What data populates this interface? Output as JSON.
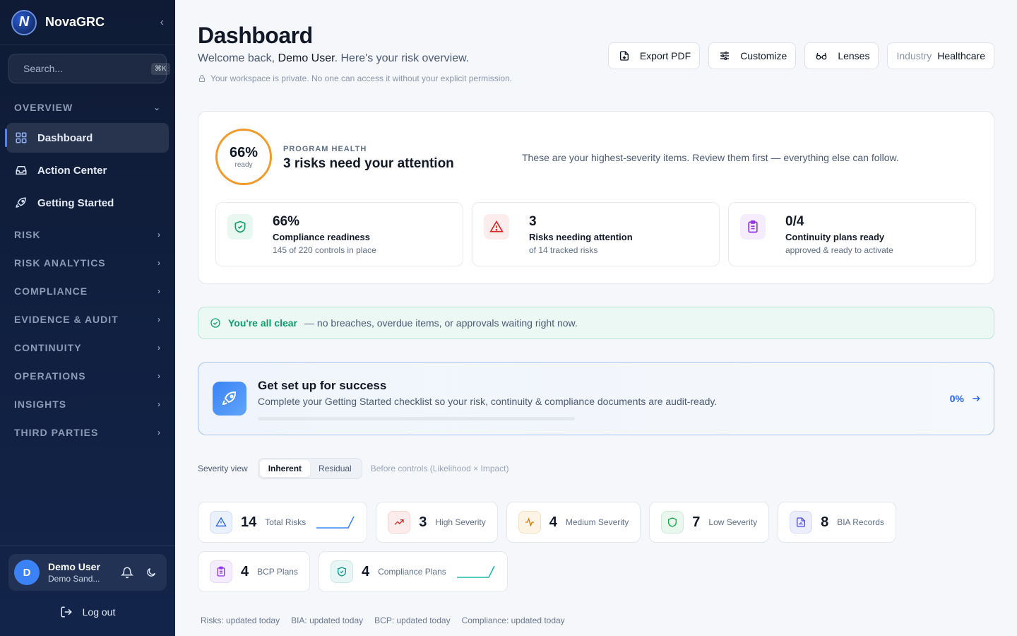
{
  "brand": {
    "name": "NovaGRC",
    "logo_letter": "N"
  },
  "search": {
    "placeholder": "Search...",
    "shortcut": "⌘K"
  },
  "sidebar": {
    "overview_label": "OVERVIEW",
    "items": [
      {
        "label": "Dashboard",
        "icon": "grid-icon",
        "active": true
      },
      {
        "label": "Action Center",
        "icon": "inbox-icon"
      },
      {
        "label": "Getting Started",
        "icon": "rocket-icon"
      }
    ],
    "sections": [
      "RISK",
      "RISK ANALYTICS",
      "COMPLIANCE",
      "EVIDENCE & AUDIT",
      "CONTINUITY",
      "OPERATIONS",
      "INSIGHTS",
      "THIRD PARTIES"
    ]
  },
  "user": {
    "initial": "D",
    "name": "Demo User",
    "org": "Demo Sand..."
  },
  "logout_label": "Log out",
  "header": {
    "title": "Dashboard",
    "welcome_prefix": "Welcome back, ",
    "welcome_name": "Demo User",
    "welcome_suffix": ". Here's your risk overview.",
    "privacy": "Your workspace is private. No one can access it without your explicit permission.",
    "export_label": "Export PDF",
    "customize_label": "Customize",
    "lenses_label": "Lenses",
    "industry_label": "Industry",
    "industry_value": "Healthcare"
  },
  "health": {
    "ring_value": "66%",
    "ring_sub": "ready",
    "ring_fraction": 0.66,
    "label": "PROGRAM HEALTH",
    "title": "3 risks need your attention",
    "description": "These are your highest-severity items. Review them first — everything else can follow.",
    "kpis": [
      {
        "value": "66%",
        "label": "Compliance readiness",
        "sub": "145 of 220 controls in place",
        "icon": "shield-check-icon",
        "color": "#0f9d6b"
      },
      {
        "value": "3",
        "label": "Risks needing attention",
        "sub": "of 14 tracked risks",
        "icon": "alert-triangle-icon",
        "color": "#dc2626"
      },
      {
        "value": "0/4",
        "label": "Continuity plans ready",
        "sub": "approved & ready to activate",
        "icon": "clipboard-icon",
        "color": "#9333ea"
      }
    ]
  },
  "clear_banner": {
    "strong": "You're all clear",
    "text": "— no breaches, overdue items, or approvals waiting right now."
  },
  "setup": {
    "title": "Get set up for success",
    "description": "Complete your Getting Started checklist so your risk, continuity & compliance documents are audit-ready.",
    "progress": 0,
    "progress_label": "0%"
  },
  "severity": {
    "label": "Severity view",
    "options": [
      "Inherent",
      "Residual"
    ],
    "selected": "Inherent",
    "hint": "Before controls (Likelihood × Impact)"
  },
  "stats": [
    {
      "value": "14",
      "label": "Total Risks",
      "icon": "alert-triangle-icon",
      "color": "#2563eb",
      "spark": true
    },
    {
      "value": "3",
      "label": "High Severity",
      "icon": "trending-up-icon",
      "color": "#dc2626"
    },
    {
      "value": "4",
      "label": "Medium Severity",
      "icon": "activity-icon",
      "color": "#d97706"
    },
    {
      "value": "7",
      "label": "Low Severity",
      "icon": "shield-icon",
      "color": "#16a34a"
    },
    {
      "value": "8",
      "label": "BIA Records",
      "icon": "file-chart-icon",
      "color": "#4f46e5"
    },
    {
      "value": "4",
      "label": "BCP Plans",
      "icon": "clipboard-icon",
      "color": "#9333ea"
    },
    {
      "value": "4",
      "label": "Compliance Plans",
      "icon": "shield-check-icon",
      "color": "#0d9488",
      "spark": true
    }
  ],
  "updates": [
    "Risks: updated today",
    "BIA: updated today",
    "BCP: updated today",
    "Compliance: updated today"
  ]
}
